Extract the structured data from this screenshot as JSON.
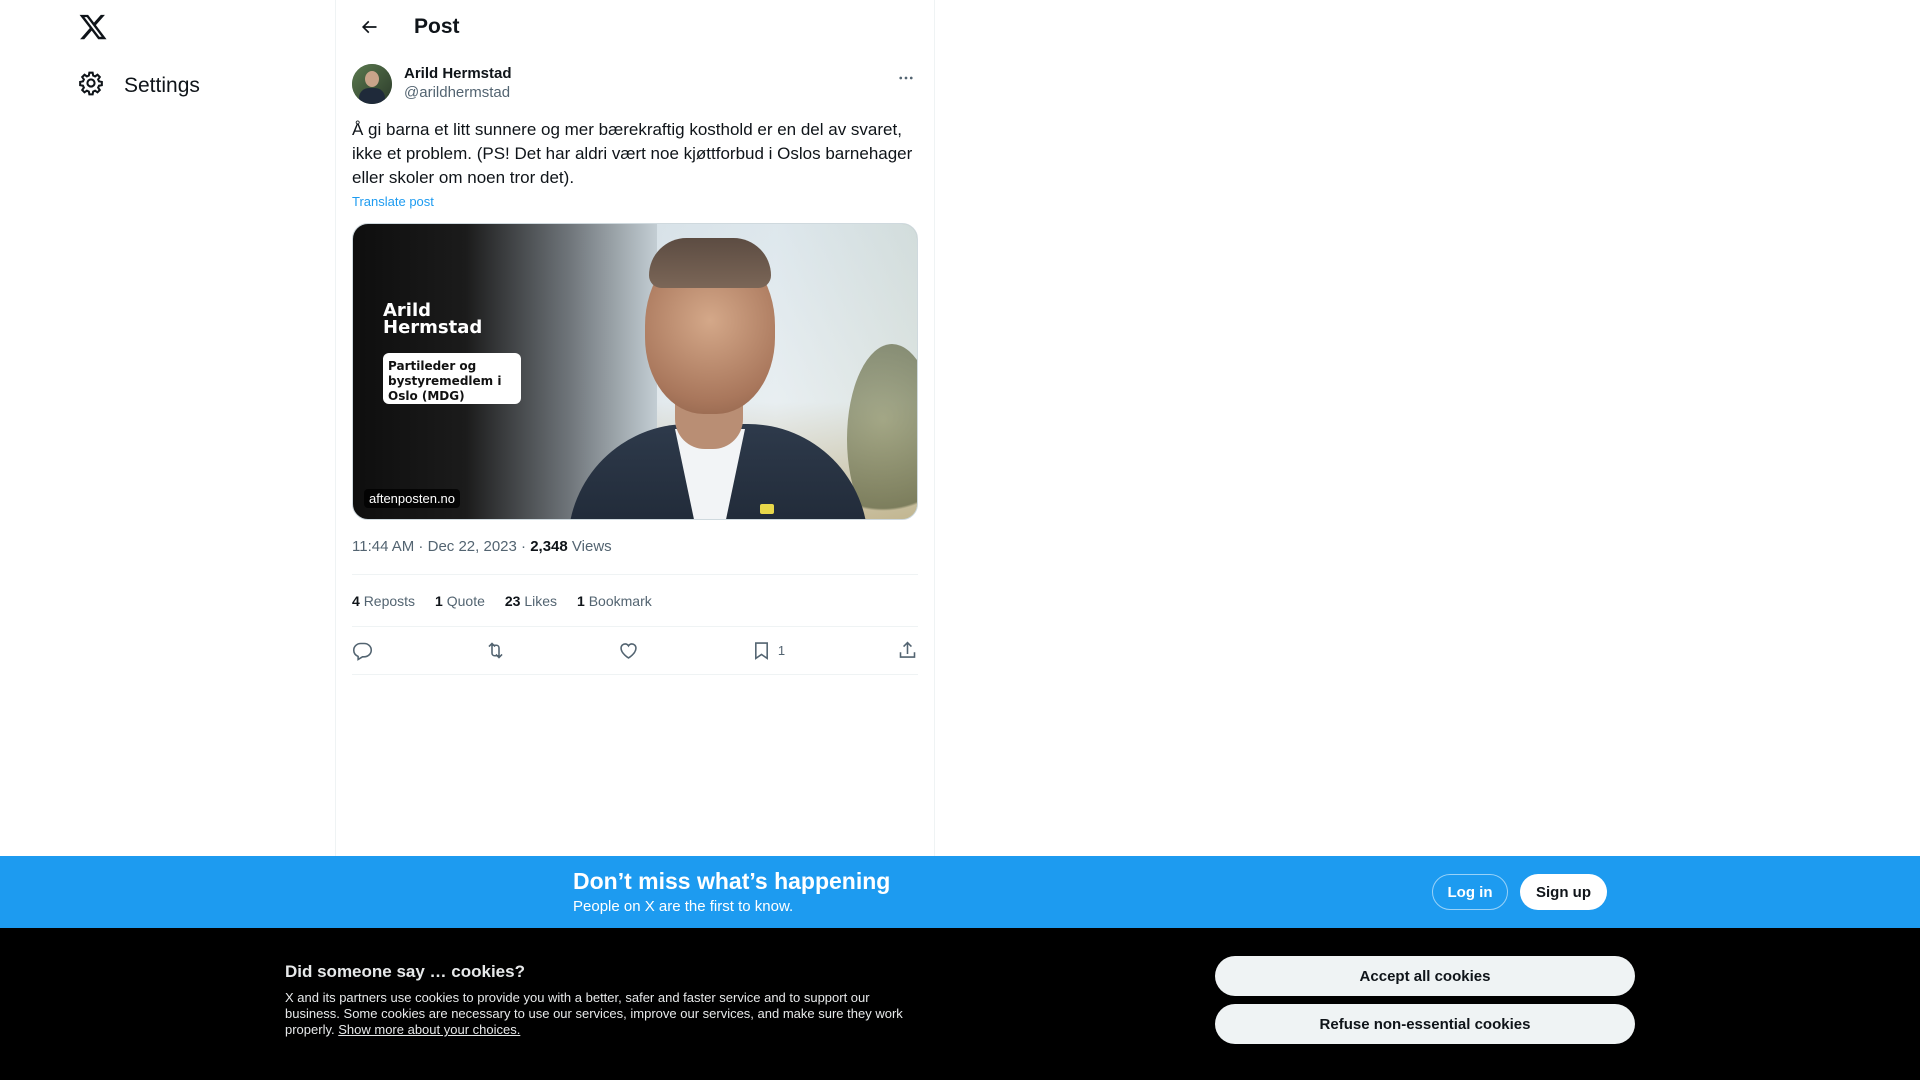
{
  "nav": {
    "logo_icon": "x-logo-icon",
    "settings_label": "Settings"
  },
  "header": {
    "title": "Post"
  },
  "post": {
    "author_name": "Arild Hermstad",
    "author_handle": "@arildhermstad",
    "text": "Å gi barna et litt sunnere og mer bærekraftig kosthold er en del av svaret, ikke et problem. (PS! Det har aldri vært noe kjøttforbud i Oslos barnehager eller skoler om noen tror det).",
    "translate_label": "Translate post",
    "media": {
      "overlay_name_line1": "Arild",
      "overlay_name_line2": "Hermstad",
      "overlay_role": "Partileder og bystyremedlem i Oslo (MDG)",
      "source": "aftenposten.no"
    },
    "time": "11:44 AM",
    "date": "Dec 22, 2023",
    "views_count": "2,348",
    "views_label": "Views",
    "stats": {
      "reposts_count": "4",
      "reposts_label": "Reposts",
      "quotes_count": "1",
      "quotes_label": "Quote",
      "likes_count": "23",
      "likes_label": "Likes",
      "bookmarks_count": "1",
      "bookmarks_label": "Bookmark"
    },
    "actions": {
      "bookmark_count": "1"
    }
  },
  "banner": {
    "headline": "Don’t miss what’s happening",
    "subtext": "People on X are the first to know.",
    "login_label": "Log in",
    "signup_label": "Sign up",
    "bg_color": "#1d9bf0"
  },
  "cookies": {
    "title": "Did someone say … cookies?",
    "text": "X and its partners use cookies to provide you with a better, safer and faster service and to support our business. Some cookies are necessary to use our services, improve our services, and make sure they work properly.",
    "link": "Show more about your choices.",
    "accept_label": "Accept all cookies",
    "refuse_label": "Refuse non-essential cookies"
  }
}
